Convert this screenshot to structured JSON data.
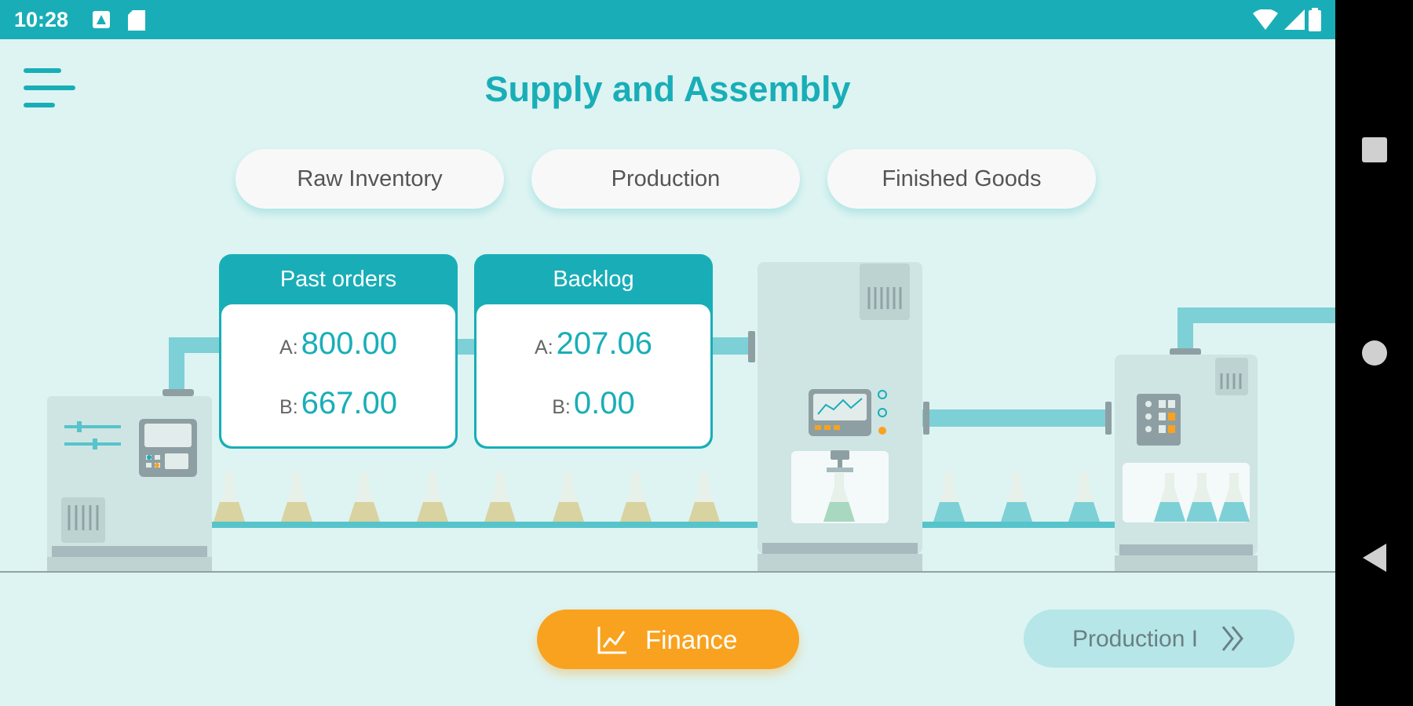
{
  "status_bar": {
    "time": "10:28"
  },
  "header": {
    "title": "Supply and Assembly"
  },
  "tabs": [
    {
      "label": "Raw Inventory"
    },
    {
      "label": "Production"
    },
    {
      "label": "Finished Goods"
    }
  ],
  "cards": {
    "past_orders": {
      "title": "Past orders",
      "a_label": "A:",
      "a_value": "800.00",
      "b_label": "B:",
      "b_value": "667.00"
    },
    "backlog": {
      "title": "Backlog",
      "a_label": "A:",
      "a_value": "207.06",
      "b_label": "B:",
      "b_value": "0.00"
    }
  },
  "footer": {
    "finance_label": "Finance",
    "production_label": "Production I"
  },
  "icons": [
    "hamburger-menu-icon",
    "image-notification-icon",
    "sd-card-icon",
    "wifi-icon",
    "cellular-signal-icon",
    "battery-icon",
    "chart-icon",
    "double-chevron-right-icon",
    "square-recents-icon",
    "circle-home-icon",
    "triangle-back-icon"
  ],
  "colors": {
    "primary": "#19AEB7",
    "background": "#DDF4F2",
    "accent": "#F9A21F",
    "secondary_button": "#B6E6E7"
  }
}
